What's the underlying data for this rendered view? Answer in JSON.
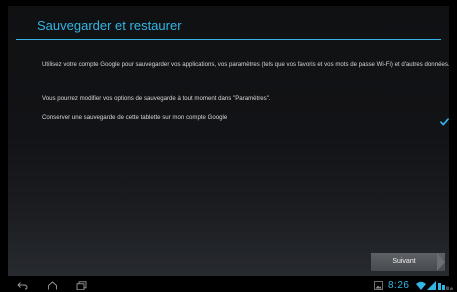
{
  "setup": {
    "title": "Sauvegarder et restaurer",
    "intro_text": "Utilisez votre compte Google pour sauvegarder vos applications, vos paramètres (tels que vos favoris et vos mots de passe Wi-Fi) et d'autres données.",
    "settings_text": "Vous pourrez modifier vos options de sauvegarde à tout moment dans \"Paramètres\".",
    "backup_option": {
      "label": "Conserver une sauvegarde de cette tablette sur mon compte Google",
      "checked": true
    },
    "next_label": "Suivant"
  },
  "system_bar": {
    "time": "8:26",
    "nav_icons": [
      "back-icon",
      "home-icon",
      "recent-apps-icon"
    ],
    "status_icons": [
      "screenshot-icon",
      "wifi-icon",
      "signal-icon",
      "battery-icon"
    ]
  },
  "colors": {
    "accent": "#33b5e5",
    "text": "#d6d6d6",
    "background": "#000000",
    "panel": "#121316",
    "button": "#4f5256"
  }
}
